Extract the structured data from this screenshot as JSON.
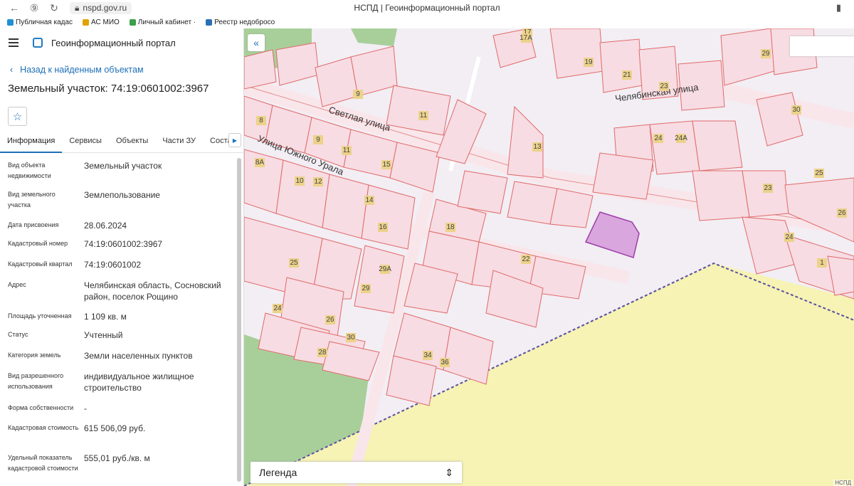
{
  "browser": {
    "url": "nspd.gov.ru",
    "tab_title": "НСПД | Геоинформационный портал",
    "bookmarks": [
      {
        "label": "Публичная кадас",
        "color": "#1f8fd6"
      },
      {
        "label": "АС МИО",
        "color": "#e0a300"
      },
      {
        "label": "Личный кабинет ·",
        "color": "#3aa04a"
      },
      {
        "label": "Реестр недобросо",
        "color": "#2b6fb5"
      }
    ]
  },
  "panel": {
    "app_title": "Геоинформационный портал",
    "back_link": "Назад к найденным объектам",
    "object_title": "Земельный участок: 74:19:0601002:3967",
    "tabs": [
      "Информация",
      "Сервисы",
      "Объекты",
      "Части ЗУ",
      "Состав"
    ],
    "fields": [
      {
        "key": "Вид объекта недвижимости",
        "value": "Земельный участок"
      },
      {
        "key": "Вид земельного участка",
        "value": "Землепользование"
      },
      {
        "key": "Дата присвоения",
        "value": "28.06.2024"
      },
      {
        "key": "Кадастровый номер",
        "value": "74:19:0601002:3967"
      },
      {
        "key": "Кадастровый квартал",
        "value": "74:19:0601002"
      },
      {
        "key": "Адрес",
        "value": "Челябинская область, Сосновский район, поселок Рощино"
      },
      {
        "key": "Площадь уточненная",
        "value": "1 109 кв. м"
      },
      {
        "key": "Статус",
        "value": "Учтенный"
      },
      {
        "key": "Категория земель",
        "value": "Земли населенных пунктов"
      },
      {
        "key": "Вид разрешенного использования",
        "value": "индивидуальное жилищное строительство"
      },
      {
        "key": "Форма собственности",
        "value": "-"
      },
      {
        "key": "Кадастровая стоимость",
        "value": "615 506,09 руб."
      },
      {
        "key": "Удельный показатель кадастровой стоимости",
        "value": "555,01 руб./кв. м"
      }
    ]
  },
  "map": {
    "legend_label": "Легенда",
    "attribution": "НСПД",
    "streets": [
      "Светлая улица",
      "Улица Южного Урала",
      "Челябинская улица"
    ],
    "parcel_numbers": [
      "17",
      "17А",
      "19",
      "21",
      "23",
      "29",
      "9",
      "8",
      "11",
      "13",
      "30",
      "24",
      "24А",
      "9",
      "11",
      "15",
      "8А",
      "10",
      "12",
      "14",
      "16",
      "18",
      "22",
      "25",
      "23",
      "26",
      "24",
      "1",
      "25",
      "29А",
      "29",
      "24",
      "26",
      "30",
      "28",
      "34",
      "36"
    ],
    "colors": {
      "parcel_line": "#e06a6a",
      "parcel_fill": "#f7dce3",
      "selected": "#c87fc8",
      "zone": "#f6f3b4",
      "green": "#a8cf9a",
      "boundary": "#5a4fa0"
    }
  }
}
